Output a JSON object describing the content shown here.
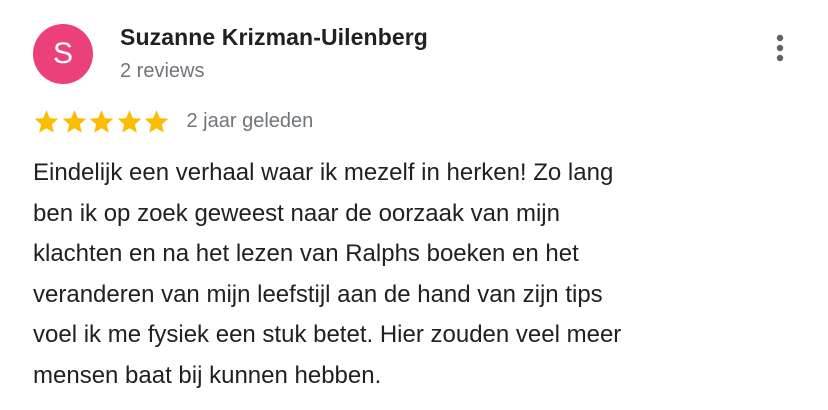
{
  "review": {
    "avatar_initial": "S",
    "author_name": "Suzanne Krizman-Uilenberg",
    "review_count": "2 reviews",
    "rating": 5,
    "rating_max": 5,
    "date": "2 jaar geleden",
    "text": "Eindelijk een verhaal waar ik mezelf in herken! Zo lang\nben ik op zoek geweest naar de oorzaak van mijn\nklachten en na het lezen van Ralphs boeken en het\nveranderen van mijn  leefstijl aan de hand van zijn tips\nvoel ik me fysiek een stuk betet. Hier zouden veel meer\nmensen baat bij kunnen hebben."
  },
  "icons": {
    "more": "more-vert-icon",
    "star": "star-icon"
  },
  "colors": {
    "avatar_bg": "#ec407a",
    "star": "#fbbc04",
    "secondary_text": "#70757a",
    "primary_text": "#202124"
  }
}
